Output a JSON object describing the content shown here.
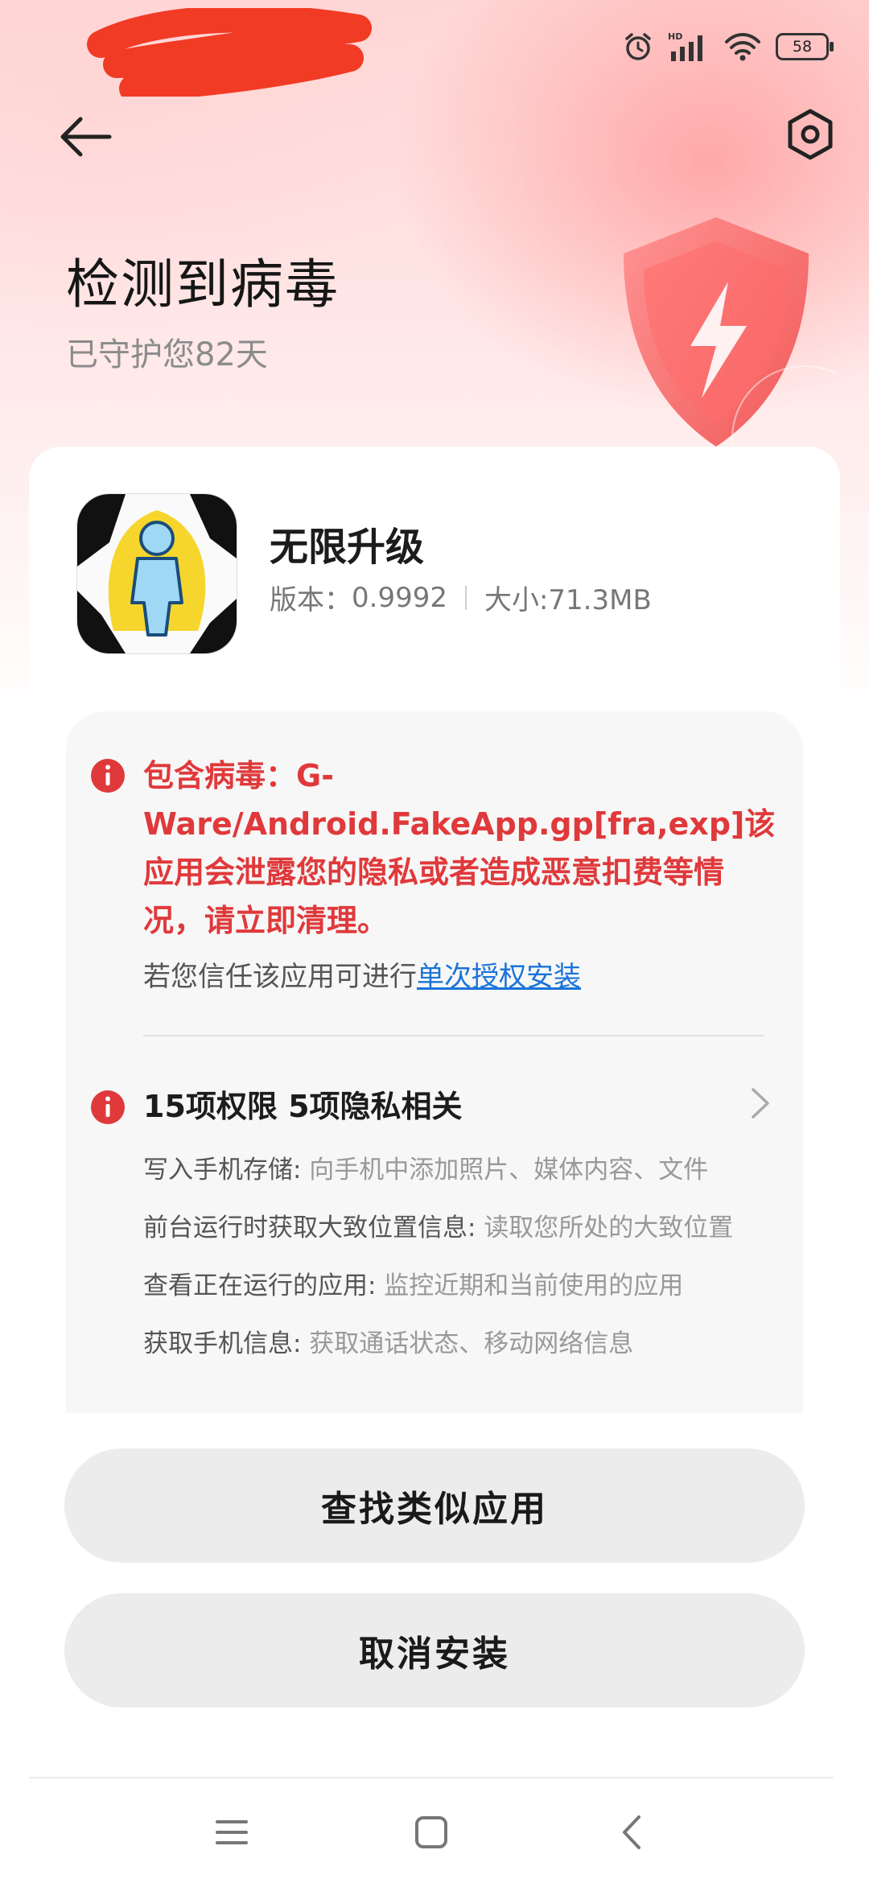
{
  "status_bar": {
    "battery": "58",
    "network_badge": "HD",
    "icons": [
      "alarm-icon",
      "signal-icon",
      "wifi-icon",
      "battery-icon"
    ]
  },
  "header": {
    "title": "检测到病毒",
    "subtitle": "已守护您82天"
  },
  "app": {
    "name": "无限升级",
    "version_label": "版本：",
    "version": "0.9992",
    "size": "大小:71.3MB"
  },
  "warning": {
    "virus_text": "包含病毒：G-Ware/Android.FakeApp.gp[fra,exp]该应用会泄露您的隐私或者造成恶意扣费等情况，请立即清理。",
    "trust_prefix": "若您信任该应用可进行",
    "trust_link": "单次授权安装"
  },
  "permissions": {
    "title": "15项权限 5项隐私相关",
    "items": [
      {
        "name": "写入手机存储:",
        "desc": " 向手机中添加照片、媒体内容、文件"
      },
      {
        "name": "前台运行时获取大致位置信息:",
        "desc": " 读取您所处的大致位置"
      },
      {
        "name": "查看正在运行的应用:",
        "desc": " 监控近期和当前使用的应用"
      },
      {
        "name": "获取手机信息:",
        "desc": " 获取通话状态、移动网络信息"
      }
    ]
  },
  "buttons": {
    "find_similar": "查找类似应用",
    "cancel_install": "取消安装"
  },
  "colors": {
    "danger": "#e0393b",
    "link": "#1a73d9",
    "button_bg": "#ececec"
  }
}
